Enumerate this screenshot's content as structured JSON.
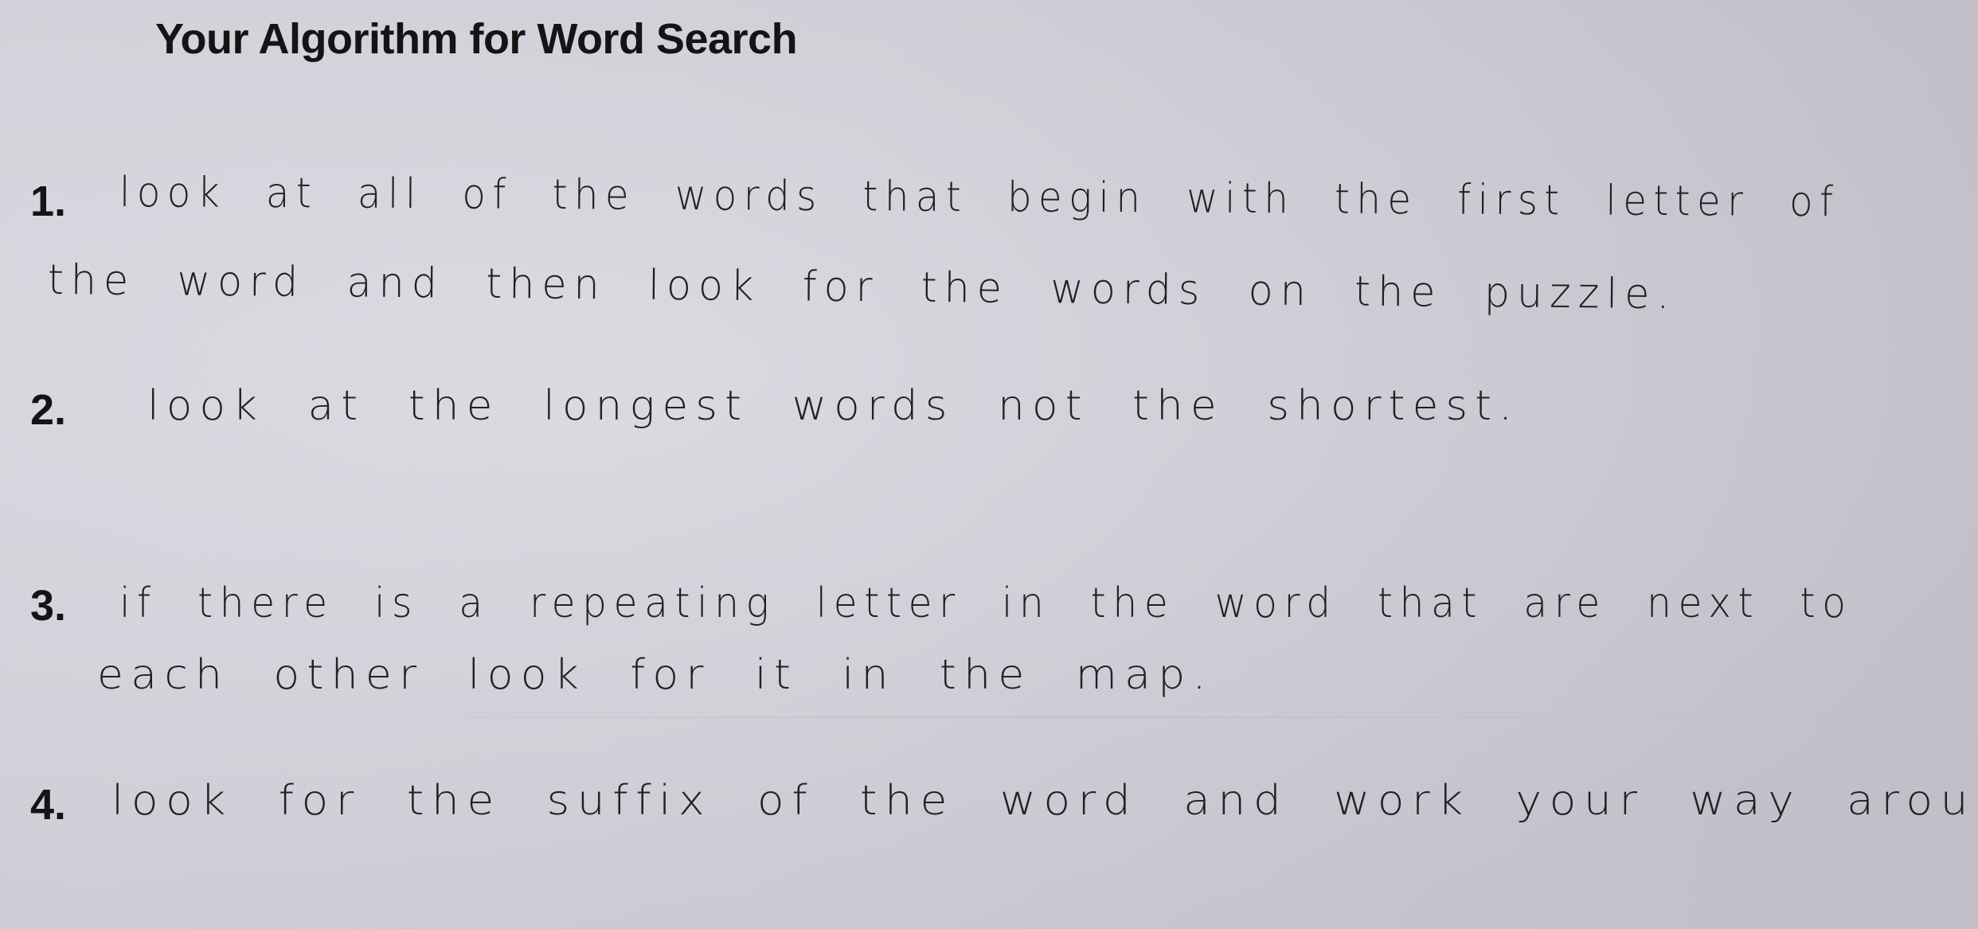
{
  "title": "Your Algorithm for Word Search",
  "steps": [
    {
      "number": "1.",
      "lines": [
        "look at all of the words that begin with the first letter of",
        "the word and then look for the words on the puzzle."
      ]
    },
    {
      "number": "2.",
      "lines": [
        "look at the longest words not the shortest."
      ]
    },
    {
      "number": "3.",
      "lines": [
        "if there is a repeating letter in the word that are next to",
        "each other look for it in the map."
      ]
    },
    {
      "number": "4.",
      "lines": [
        "look for the suffix of the word and work your way around."
      ]
    }
  ]
}
